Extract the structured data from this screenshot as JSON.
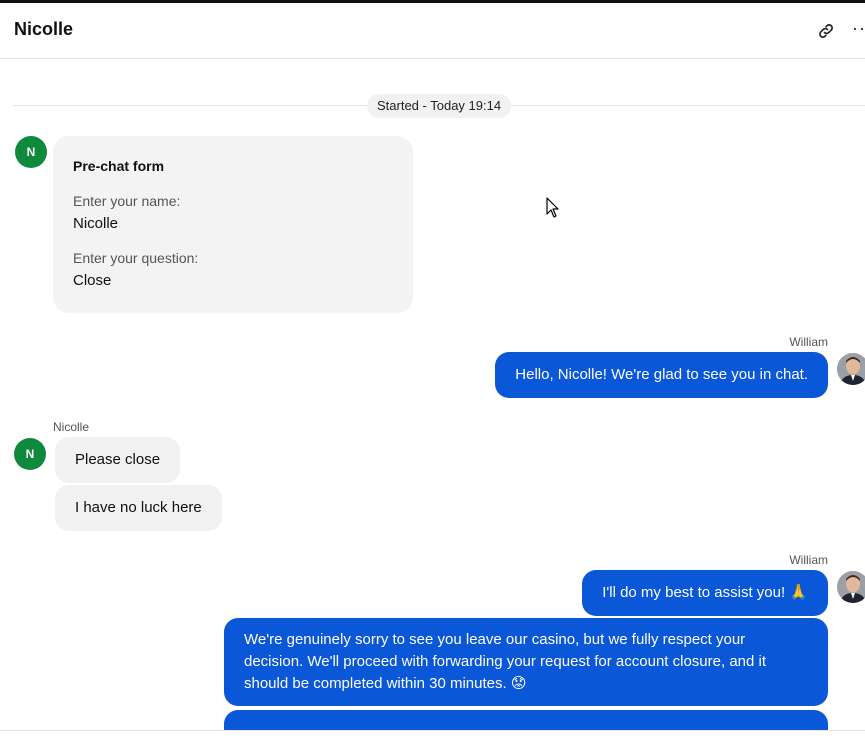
{
  "header": {
    "title": "Nicolle",
    "link_icon": "link-icon",
    "more_icon": "more-icon"
  },
  "chat": {
    "started_label": "Started - Today 19:14",
    "prechat_form": {
      "avatar_initial": "N",
      "title": "Pre-chat form",
      "fields": [
        {
          "label": "Enter your name:",
          "value": "Nicolle"
        },
        {
          "label": "Enter your question:",
          "value": "Close"
        }
      ]
    },
    "messages": [
      {
        "sender": "William",
        "direction": "outgoing",
        "bubbles": [
          "Hello, Nicolle! We're glad to see you in chat."
        ]
      },
      {
        "sender": "Nicolle",
        "direction": "incoming",
        "avatar_initial": "N",
        "bubbles": [
          "Please close",
          "I have no luck here"
        ]
      },
      {
        "sender": "William",
        "direction": "outgoing",
        "bubbles": [
          "I'll do my best to assist you! 🙏",
          "We're genuinely sorry to see you leave our casino, but we fully respect your decision. We'll proceed with forwarding your request for account closure, and it should be completed within 30 minutes. 😟"
        ]
      }
    ]
  },
  "colors": {
    "outgoing_bubble": "#0a57d8",
    "incoming_bubble": "#f1f1f1",
    "avatar_green": "#0f8a3c"
  }
}
